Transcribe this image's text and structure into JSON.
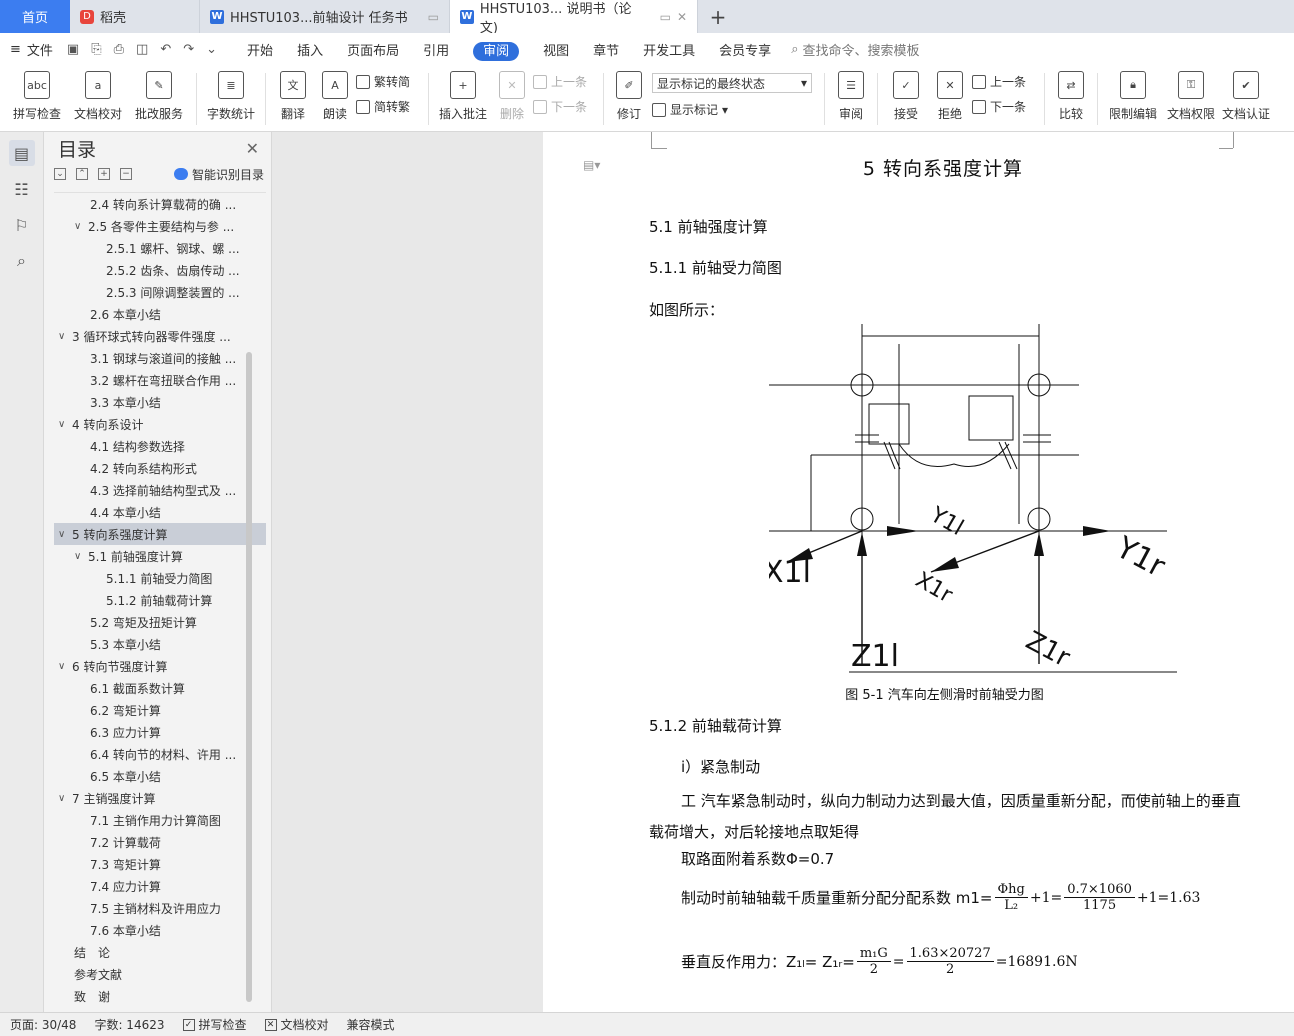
{
  "tabs": {
    "home": "首页",
    "daoke": "稻壳",
    "doc1": "HHSTU103...前轴设计 任务书",
    "doc2": "HHSTU103... 说明书（论文)"
  },
  "menu": {
    "file": "文件",
    "items": [
      "开始",
      "插入",
      "页面布局",
      "引用",
      "审阅",
      "视图",
      "章节",
      "开发工具",
      "会员专享"
    ],
    "active": "审阅",
    "search": "查找命令、搜索模板"
  },
  "ribbon": {
    "spell": "拼写检查",
    "proof": "文档校对",
    "batch": "批改服务",
    "wordcount": "字数统计",
    "translate": "翻译",
    "read": "朗读",
    "trad_to_simp": "繁转简",
    "simp_to_trad": "简转繁",
    "insert_comment": "插入批注",
    "delete": "删除",
    "prev": "上一条",
    "next": "下一条",
    "track": "修订",
    "markup_state": "显示标记的最终状态",
    "show_markup": "显示标记",
    "review": "审阅",
    "accept": "接受",
    "reject": "拒绝",
    "prev2": "上一条",
    "next2": "下一条",
    "compare": "比较",
    "restrict": "限制编辑",
    "permission": "文档权限",
    "certify": "文档认证"
  },
  "toc": {
    "title": "目录",
    "smart": "智能识别目录",
    "items": [
      {
        "level": "l2 leaf",
        "arrow": "",
        "text": "2.4 转向系计算载荷的确 ..."
      },
      {
        "level": "l2",
        "arrow": "∨",
        "text": "2.5 各零件主要结构与参 ..."
      },
      {
        "level": "l3",
        "arrow": "",
        "text": "2.5.1 螺杆、钢球、螺 ..."
      },
      {
        "level": "l3",
        "arrow": "",
        "text": "2.5.2 齿条、齿扇传动 ..."
      },
      {
        "level": "l3",
        "arrow": "",
        "text": "2.5.3 间隙调整装置的 ..."
      },
      {
        "level": "l2 leaf",
        "arrow": "",
        "text": "2.6 本章小结"
      },
      {
        "level": "l1",
        "arrow": "∨",
        "text": "3 循环球式转向器零件强度 ..."
      },
      {
        "level": "l2 leaf",
        "arrow": "",
        "text": "3.1 钢球与滚道间的接触 ..."
      },
      {
        "level": "l2 leaf",
        "arrow": "",
        "text": "3.2 螺杆在弯扭联合作用 ..."
      },
      {
        "level": "l2 leaf",
        "arrow": "",
        "text": "3.3 本章小结"
      },
      {
        "level": "l1",
        "arrow": "∨",
        "text": "4 转向系设计"
      },
      {
        "level": "l2 leaf",
        "arrow": "",
        "text": "4.1 结构参数选择"
      },
      {
        "level": "l2 leaf",
        "arrow": "",
        "text": "4.2 转向系结构形式"
      },
      {
        "level": "l2 leaf",
        "arrow": "",
        "text": "4.3 选择前轴结构型式及 ..."
      },
      {
        "level": "l2 leaf",
        "arrow": "",
        "text": "4.4 本章小结"
      },
      {
        "level": "l1 sel",
        "arrow": "∨",
        "text": "5 转向系强度计算"
      },
      {
        "level": "l2",
        "arrow": "∨",
        "text": "5.1 前轴强度计算"
      },
      {
        "level": "l3",
        "arrow": "",
        "text": "5.1.1 前轴受力简图"
      },
      {
        "level": "l3",
        "arrow": "",
        "text": "5.1.2 前轴载荷计算"
      },
      {
        "level": "l2 leaf",
        "arrow": "",
        "text": "5.2 弯矩及扭矩计算"
      },
      {
        "level": "l2 leaf",
        "arrow": "",
        "text": "5.3 本章小结"
      },
      {
        "level": "l1",
        "arrow": "∨",
        "text": "6 转向节强度计算"
      },
      {
        "level": "l2 leaf",
        "arrow": "",
        "text": "6.1 截面系数计算"
      },
      {
        "level": "l2 leaf",
        "arrow": "",
        "text": "6.2 弯矩计算"
      },
      {
        "level": "l2 leaf",
        "arrow": "",
        "text": "6.3 应力计算"
      },
      {
        "level": "l2 leaf",
        "arrow": "",
        "text": "6.4 转向节的材料、许用 ..."
      },
      {
        "level": "l2 leaf",
        "arrow": "",
        "text": "6.5 本章小结"
      },
      {
        "level": "l1",
        "arrow": "∨",
        "text": "7 主销强度计算"
      },
      {
        "level": "l2 leaf",
        "arrow": "",
        "text": "7.1 主销作用力计算简图"
      },
      {
        "level": "l2 leaf",
        "arrow": "",
        "text": "7.2 计算载荷"
      },
      {
        "level": "l2 leaf",
        "arrow": "",
        "text": "7.3 弯矩计算"
      },
      {
        "level": "l2 leaf",
        "arrow": "",
        "text": "7.4 应力计算"
      },
      {
        "level": "l2 leaf",
        "arrow": "",
        "text": "7.5 主销材料及许用应力"
      },
      {
        "level": "l2 leaf",
        "arrow": "",
        "text": "7.6 本章小结"
      },
      {
        "level": "l1 leaf",
        "arrow": "",
        "text": "结　论"
      },
      {
        "level": "l1 leaf",
        "arrow": "",
        "text": "参考文献"
      },
      {
        "level": "l1 leaf",
        "arrow": "",
        "text": "致　谢"
      }
    ]
  },
  "doc": {
    "h1": "5  转向系强度计算",
    "h2": "5.1  前轴强度计算",
    "h3": "5.1.1  前轴受力简图",
    "p1": "如图所示：",
    "fig_labels": {
      "x1l": "X1l",
      "y1l": "Y1l",
      "y1r": "Y1r",
      "x1r": "X1r",
      "z1l": "Z1l",
      "z1r": "Z1r"
    },
    "caption": "图 5-1  汽车向左侧滑时前轴受力图",
    "h3b": "5.1.2  前轴载荷计算",
    "sub": "i）紧急制动",
    "para": "工  汽车紧急制动时，纵向力制动力达到最大值，因质量重新分配，而使前轴上的垂直载荷增大，对后轮接地点取矩得",
    "phi_line": "取路面附着系数Φ=0.7",
    "m1_prefix": "制动时前轴轴载千质量重新分配分配系数 m1=",
    "m1_num": "Φhg",
    "m1_den": "L₂",
    "m1_mid": "+1=",
    "m1_num2": "0.7×1060",
    "m1_den2": "1175",
    "m1_end": "+1=1.63",
    "z_prefix": "垂直反作用力：Z₁ₗ= Z₁ᵣ=",
    "z_num": "m₁G",
    "z_den": "2",
    "z_eq": "=",
    "z_num2": "1.63×20727",
    "z_den2": "2",
    "z_end": "=16891.6N"
  },
  "status": {
    "page": "页面: 30/48",
    "words": "字数: 14623",
    "spell": "拼写检查",
    "proof": "文档校对",
    "compat": "兼容模式"
  }
}
